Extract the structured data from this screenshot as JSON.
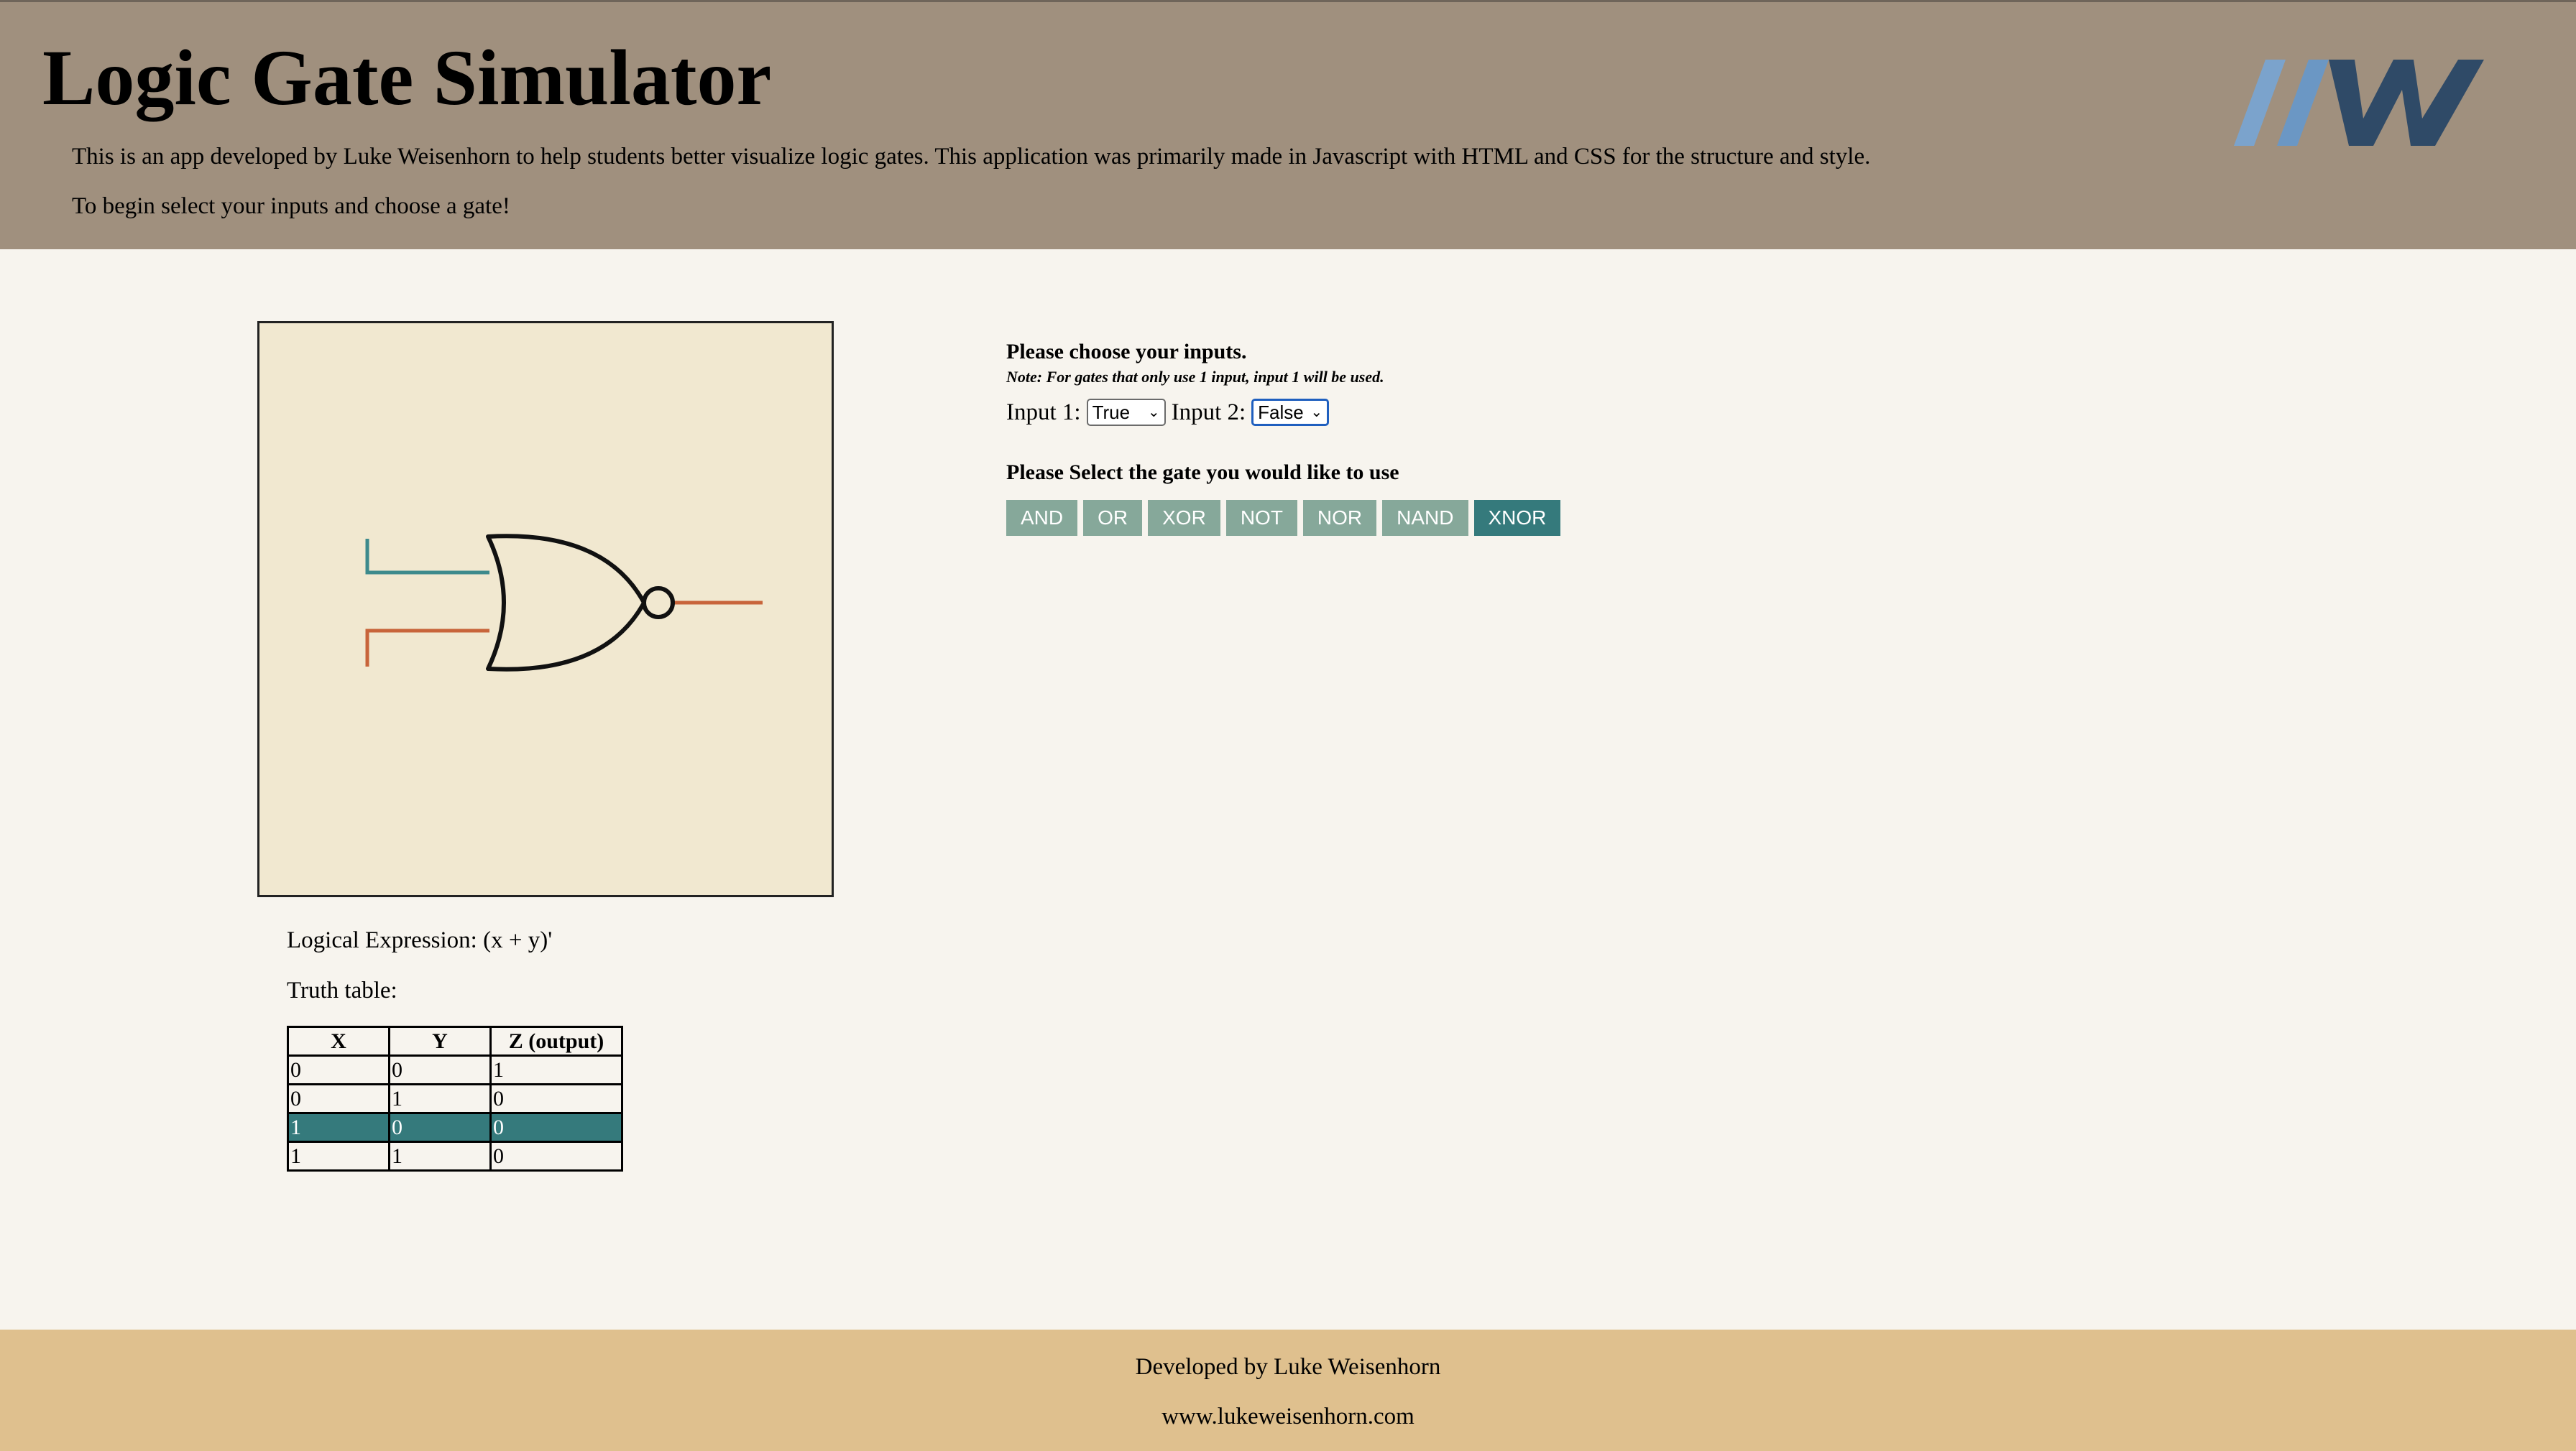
{
  "header": {
    "title": "Logic Gate Simulator",
    "intro": "This is an app developed by Luke Weisenhorn to help students better visualize logic gates. This application was primarily made in Javascript with HTML and CSS for the structure and style.",
    "instructions": "To begin select your inputs and choose a gate!",
    "logo_icon": "lw-logo-icon"
  },
  "simulator": {
    "gate_icon": "nor-gate-icon",
    "expression": "Logical Expression: (x + y)'",
    "truth_label": "Truth table:",
    "truth_table": {
      "headers": [
        "X",
        "Y",
        "Z (output)"
      ],
      "rows": [
        [
          "0",
          "0",
          "1"
        ],
        [
          "0",
          "1",
          "0"
        ],
        [
          "1",
          "0",
          "0"
        ],
        [
          "1",
          "1",
          "0"
        ]
      ],
      "highlighted_row": 2
    }
  },
  "controls": {
    "choose_label": "Please choose your inputs.",
    "note": "Note: For gates that only use 1 input, input 1 will be used.",
    "input1_label": "Input 1:",
    "input1_value": "True",
    "input2_label": "Input 2:",
    "input2_value": "False",
    "gate_label": "Please Select the gate you would like to use",
    "gates": [
      "AND",
      "OR",
      "XOR",
      "NOT",
      "NOR",
      "NAND",
      "XNOR"
    ],
    "active_gate": "XNOR"
  },
  "footer": {
    "credit": "Developed by Luke Weisenhorn",
    "website": "www.lukeweisenhorn.com"
  },
  "colors": {
    "header_bg": "#a0907e",
    "page_bg": "#f7f4ee",
    "canvas_bg": "#f1e8d0",
    "input1_wire": "#3d8a8c",
    "input2_wire": "#c8643a",
    "output_wire": "#c8643a",
    "gate_button": "#86a89a",
    "gate_button_active": "#357a7c",
    "footer_bg": "#dfc08e"
  }
}
